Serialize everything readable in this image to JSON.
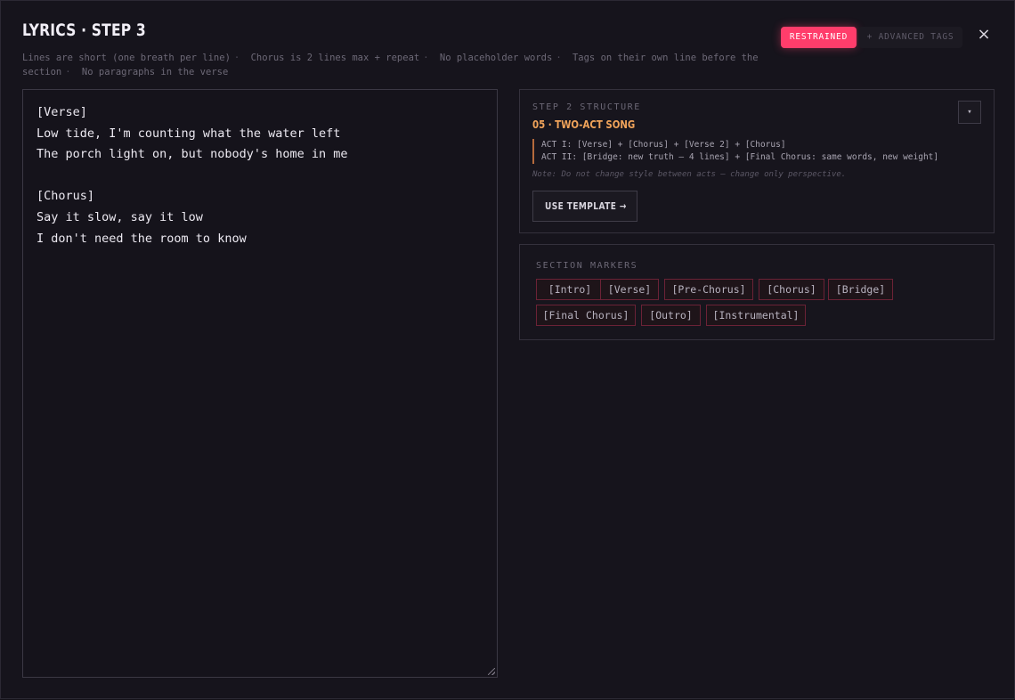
{
  "header": {
    "title": "LYRICS · STEP 3",
    "rules": [
      "Lines are short (one breath per line)",
      "Chorus is 2 lines max + repeat",
      "No placeholder words",
      "Tags on their own line before the section",
      "No paragraphs in the verse"
    ],
    "rule_separator": "·",
    "mode_label": "RESTRAINED",
    "advanced_label": "+ ADVANCED TAGS",
    "close_label": "×"
  },
  "editor": {
    "lines": [
      "[Verse]",
      "Low tide, I'm counting what the water left",
      "The porch light on, but nobody's home in me",
      "",
      "[Chorus]",
      "Say it slow, say it low",
      "I don't need the room to know"
    ]
  },
  "structure": {
    "eyebrow": "STEP 2 STRUCTURE",
    "template_name": "05 · TWO-ACT SONG",
    "dropdown_icon": "▾",
    "act_1": "ACT I: [Verse] + [Chorus] + [Verse 2] + [Chorus]",
    "act_2": "ACT II: [Bridge: new truth — 4 lines] + [Final Chorus: same words, new weight]",
    "note": "Note: Do not change style between acts — change only perspective.",
    "use_template_label": "USE TEMPLATE →"
  },
  "markers": {
    "eyebrow": "SECTION MARKERS",
    "items": [
      "[Intro]",
      "[Verse]",
      "[Pre-Chorus]",
      "[Chorus]",
      "[Bridge]",
      "[Final Chorus]",
      "[Outro]",
      "[Instrumental]"
    ]
  },
  "colors": {
    "accent": "#ff3d6b",
    "template_accent": "#f0a35a",
    "marker_border": "#6b2236"
  }
}
